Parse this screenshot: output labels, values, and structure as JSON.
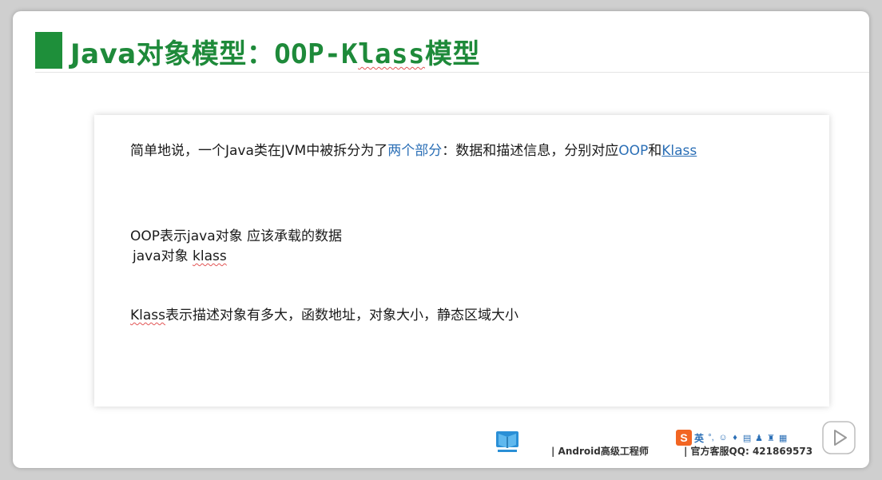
{
  "slide": {
    "title": {
      "prefix": "Java对象模型：",
      "mono_part": "OOP-K",
      "squiggle_part": "lass",
      "suffix": "模型"
    },
    "lines": {
      "l1_a": "简单地说，一个Java类在JVM中被拆分为了",
      "l1_b": "两个部分",
      "l1_c": "：数据和描述信息，分别对应",
      "l1_d": "OOP",
      "l1_e": "和",
      "l1_f": "Klass",
      "l2": "OOP表示java对象 应该承载的数据",
      "l3_a": "java对象 ",
      "l3_b": "klass",
      "l4_a": "Klass",
      "l4_b": "表示描述对象有多大，函数地址，对象大小，静态区域大小"
    }
  },
  "footer": {
    "brand": "| Android高级工程师",
    "qq": "| 官方客服QQ:  421869573",
    "ime_label": "S",
    "ime_lang": "英",
    "logo_icon": "book-logo-icon",
    "play_icon": "play-icon"
  },
  "colors": {
    "title_green": "#1e8a3a",
    "accent_blue": "#2b6fb6",
    "squiggle_red": "#e25555"
  }
}
